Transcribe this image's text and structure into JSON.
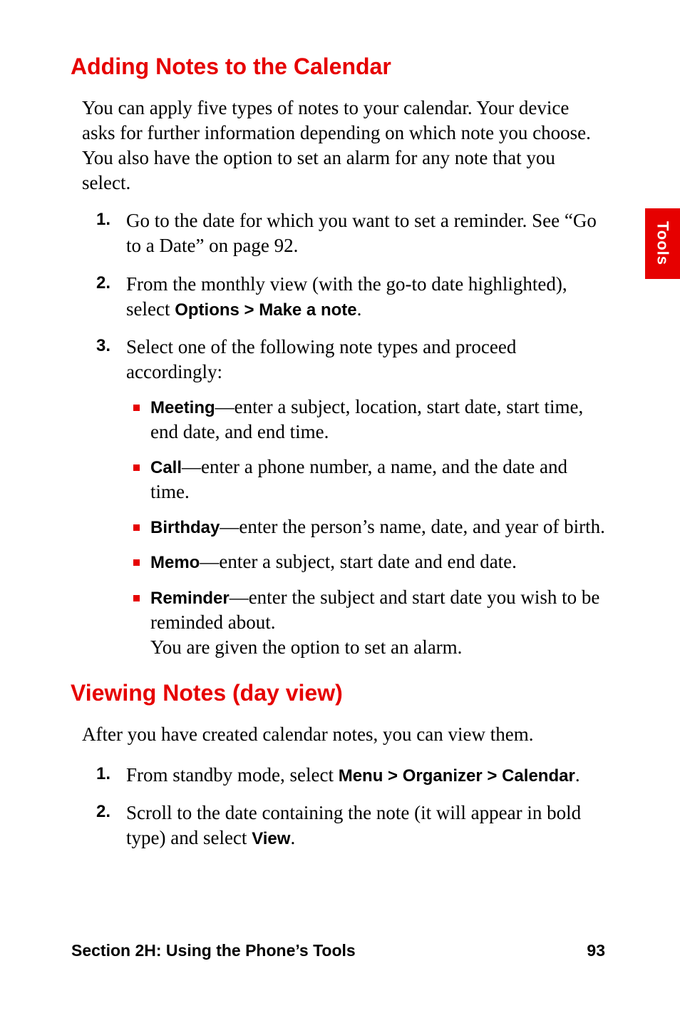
{
  "sideTab": "Tools",
  "section1": {
    "heading": "Adding Notes to the Calendar",
    "intro": "You can apply five types of notes to your calendar. Your device asks for further information depending on which note you choose. You also have the option to set an alarm for any note that you select.",
    "steps": [
      {
        "n": "1.",
        "text": "Go to the date for which you want to set a reminder. See “Go to a Date” on page 92."
      },
      {
        "n": "2.",
        "prefix": "From the monthly view (with the go-to date highlighted), select ",
        "bold": "Options > Make a note",
        "suffix": "."
      },
      {
        "n": "3.",
        "text": "Select one of the following note types and proceed accordingly:"
      }
    ],
    "bullets": [
      {
        "bold": "Meeting",
        "text": "—enter a subject, location, start date, start time, end date, and end time."
      },
      {
        "bold": "Call",
        "text": "—enter a phone number, a name, and the date and time."
      },
      {
        "bold": "Birthday",
        "text": "—enter the person’s name, date, and year of birth."
      },
      {
        "bold": "Memo",
        "text": "—enter a subject, start date and end date."
      },
      {
        "bold": "Reminder",
        "text": "—enter the subject and start date you wish to be reminded about.",
        "extra": "You are given the option to set an alarm."
      }
    ]
  },
  "section2": {
    "heading": "Viewing Notes (day view)",
    "intro": "After you have created calendar notes, you can view them.",
    "steps": [
      {
        "n": "1.",
        "prefix": "From standby mode, select ",
        "bold": "Menu > Organizer > Calendar",
        "suffix": "."
      },
      {
        "n": "2.",
        "prefix": "Scroll to the date containing the note (it will appear in bold type) and select ",
        "bold": "View",
        "suffix": "."
      }
    ]
  },
  "footer": {
    "left": "Section 2H: Using the Phone’s Tools",
    "right": "93"
  }
}
